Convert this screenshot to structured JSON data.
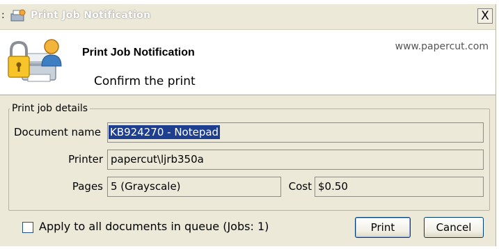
{
  "window": {
    "title": "Print Job Notification",
    "close_glyph": "X"
  },
  "header": {
    "title": "Print Job Notification",
    "subtitle": "Confirm the print",
    "url": "www.papercut.com",
    "logo_icon": "lock-printer-user-icon"
  },
  "details": {
    "legend": "Print job details",
    "document_name_label": "Document name",
    "document_name_value": "KB924270 - Notepad",
    "printer_label": "Printer",
    "printer_value": "papercut\\ljrb350a",
    "pages_label": "Pages",
    "pages_value": "5  (Grayscale)",
    "cost_label": "Cost",
    "cost_value": "$0.50"
  },
  "footer": {
    "apply_all_label": "Apply to all documents in queue (Jobs: 1)",
    "apply_all_checked": false,
    "print_label": "Print",
    "cancel_label": "Cancel"
  },
  "colors": {
    "dialog_bg": "#ece9d8",
    "selection": "#1e3f8f",
    "button_border": "#003c74"
  }
}
